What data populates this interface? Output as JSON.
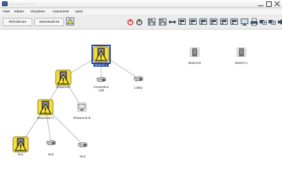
{
  "window": {
    "title": "LAN Monitor Ver 1.0",
    "icon": "app-icon"
  },
  "menu": [
    "Fișier",
    "Editare",
    "Vizualizare",
    "Instrumente",
    "Ajutor"
  ],
  "toolbar": {
    "refresh_label": "Reîncărcare",
    "select_all_label": "Selectează tot",
    "tool_icons": [
      "power-on-icon",
      "standby-icon",
      "input-icon",
      "input-icon",
      "network-icon",
      "screen-icon",
      "screen-icon",
      "screen-icon",
      "screen-icon",
      "screen-icon",
      "screen-icon",
      "monitor-icon",
      "printer-icon",
      "group-icon",
      "group-icon",
      "audio-icon"
    ],
    "colors": {
      "power": "#d02020",
      "standby": "#303030",
      "tool": "#3a4a5a"
    }
  },
  "tree": {
    "nodes": [
      {
        "label": "Branch A",
        "icon": "warning-icon",
        "selected": true
      },
      {
        "label": "Showroom",
        "icon": "warning-icon"
      },
      {
        "label": "Convention Hall",
        "icon": "projector-icon"
      },
      {
        "label": "Lobby",
        "icon": "projector-icon"
      },
      {
        "label": "Showroom A",
        "icon": "warning-icon"
      },
      {
        "label": "Showroom B",
        "icon": "projector-icon"
      },
      {
        "label": "No1",
        "icon": "warning-icon"
      },
      {
        "label": "No2",
        "icon": "projector-icon"
      },
      {
        "label": "No3",
        "icon": "projector-icon"
      },
      {
        "label": "Branch B",
        "icon": "folder-group-icon"
      },
      {
        "label": "Branch C",
        "icon": "folder-group-icon"
      }
    ],
    "colors": {
      "warning": "#f5e03a",
      "selection": "#1a3d9e",
      "line": "#9a9a9a"
    }
  }
}
